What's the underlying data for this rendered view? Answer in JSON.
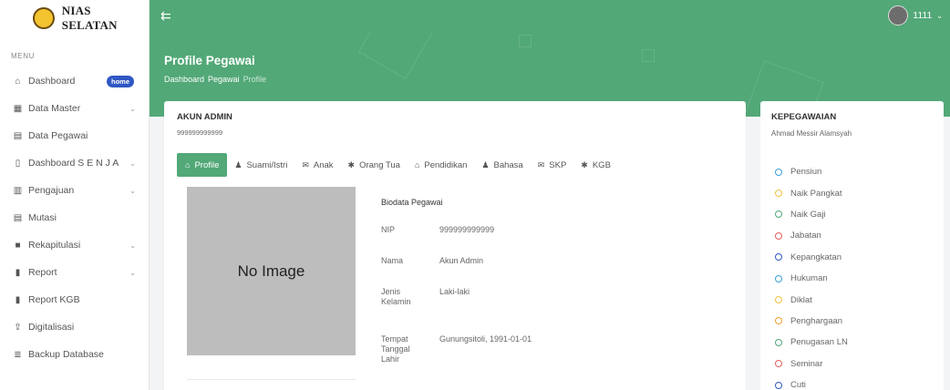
{
  "brand": {
    "name": "NIAS SELATAN"
  },
  "sidebar": {
    "menu_title": "MENU",
    "items": [
      {
        "label": "Dashboard",
        "icon": "home-icon",
        "glyph": "⌂",
        "badge": "home"
      },
      {
        "label": "Data Master",
        "icon": "table-icon",
        "glyph": "▦",
        "chevron": true
      },
      {
        "label": "Data Pegawai",
        "icon": "id-card-icon",
        "glyph": "▤"
      },
      {
        "label": "Dashboard S E N J A",
        "icon": "tablet-icon",
        "glyph": "▯",
        "chevron": true
      },
      {
        "label": "Pengajuan",
        "icon": "building-icon",
        "glyph": "▥",
        "chevron": true
      },
      {
        "label": "Mutasi",
        "icon": "id-card-icon",
        "glyph": "▤"
      },
      {
        "label": "Rekapitulasi",
        "icon": "book-icon",
        "glyph": "■",
        "chevron": true
      },
      {
        "label": "Report",
        "icon": "file-icon",
        "glyph": "▮",
        "chevron": true
      },
      {
        "label": "Report KGB",
        "icon": "file-icon",
        "glyph": "▮"
      },
      {
        "label": "Digitalisasi",
        "icon": "upload-icon",
        "glyph": "⇪"
      },
      {
        "label": "Backup Database",
        "icon": "database-icon",
        "glyph": "≣"
      }
    ]
  },
  "topbar": {
    "username": "1111"
  },
  "header": {
    "title": "Profile Pegawai",
    "breadcrumb": [
      "Dashboard",
      "Pegawai",
      "Profile"
    ]
  },
  "profile_card": {
    "title": "AKUN ADMIN",
    "subtitle": "999999999999",
    "tabs": [
      {
        "label": "Profile",
        "icon": "home-icon",
        "glyph": "⌂",
        "active": true
      },
      {
        "label": "Suami/Istri",
        "icon": "user-icon",
        "glyph": "♟"
      },
      {
        "label": "Anak",
        "icon": "mail-icon",
        "glyph": "✉"
      },
      {
        "label": "Orang Tua",
        "icon": "gear-icon",
        "glyph": "✱"
      },
      {
        "label": "Pendidikan",
        "icon": "home-icon",
        "glyph": "⌂"
      },
      {
        "label": "Bahasa",
        "icon": "user-icon",
        "glyph": "♟"
      },
      {
        "label": "SKP",
        "icon": "mail-icon",
        "glyph": "✉"
      },
      {
        "label": "KGB",
        "icon": "gear-icon",
        "glyph": "✱"
      }
    ],
    "no_image_text": "No Image",
    "biodata_title": "Biodata Pegawai",
    "fields": [
      {
        "label": "NIP",
        "value": "999999999999"
      },
      {
        "label": "Nama",
        "value": "Akun Admin"
      },
      {
        "label": "Jenis Kelamin",
        "value": "Laki-laki"
      },
      {
        "label": "Tempat Tanggal Lahir",
        "value": "Gunungsitoli, 1991-01-01"
      }
    ]
  },
  "side_card": {
    "title": "KEPEGAWAIAN",
    "subtitle": "Ahmad Messir Alamsyah",
    "items": [
      {
        "label": "Pensiun",
        "color": "#3aa0d8"
      },
      {
        "label": "Naik Pangkat",
        "color": "#f0c040"
      },
      {
        "label": "Naik Gaji",
        "color": "#52a877"
      },
      {
        "label": "Jabatan",
        "color": "#e35d5d"
      },
      {
        "label": "Kepangkatan",
        "color": "#2f57c4"
      },
      {
        "label": "Hukuman",
        "color": "#3aa0d8"
      },
      {
        "label": "Diklat",
        "color": "#f0c040"
      },
      {
        "label": "Penghargaan",
        "color": "#f0a030"
      },
      {
        "label": "Penugasan LN",
        "color": "#52a877"
      },
      {
        "label": "Seminar",
        "color": "#e35d5d"
      },
      {
        "label": "Cuti",
        "color": "#2f57c4"
      }
    ]
  },
  "colors": {
    "primary": "#52a877",
    "badge": "#2f57c4"
  }
}
